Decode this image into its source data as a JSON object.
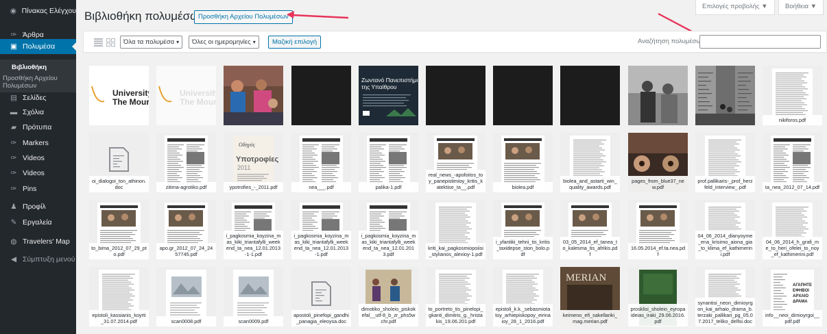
{
  "sidebar": {
    "items": [
      {
        "label": "Πίνακας Ελέγχου",
        "icon": "dashboard-icon",
        "glyph": "◉"
      },
      {
        "label": "Άρθρα",
        "icon": "pin-icon",
        "glyph": "✑"
      },
      {
        "label": "Πολυμέσα",
        "icon": "media-icon",
        "glyph": "▣"
      },
      {
        "label": "Σελίδες",
        "icon": "page-icon",
        "glyph": "▤"
      },
      {
        "label": "Σχόλια",
        "icon": "comments-icon",
        "glyph": "▬"
      },
      {
        "label": "Πρότυπα",
        "icon": "folder-icon",
        "glyph": "▰"
      },
      {
        "label": "Markers",
        "icon": "pin-icon",
        "glyph": "✑"
      },
      {
        "label": "Videos",
        "icon": "pin-icon",
        "glyph": "✑"
      },
      {
        "label": "Videos",
        "icon": "pin-icon",
        "glyph": "✑"
      },
      {
        "label": "Pins",
        "icon": "pin-icon",
        "glyph": "✑"
      },
      {
        "label": "Προφίλ",
        "icon": "user-icon",
        "glyph": "♟"
      },
      {
        "label": "Εργαλεία",
        "icon": "wrench-icon",
        "glyph": "✎"
      },
      {
        "label": "Travelers' Map",
        "icon": "globe-icon",
        "glyph": "◍"
      },
      {
        "label": "Σύμπτυξη μενού",
        "icon": "collapse-icon",
        "glyph": "◀"
      }
    ],
    "submenu": {
      "library": "Βιβλιοθήκη",
      "add_new_line1": "Προσθήκη Αρχείου",
      "add_new_line2": "Πολυμέσων"
    }
  },
  "header": {
    "title": "Βιβλιοθήκη πολυμέσων",
    "add_new": "Προσθήκη Αρχείου Πολυμέσων",
    "screen_options": "Επιλογές προβολής ▼",
    "help": "Βοήθεια ▼"
  },
  "filters": {
    "media_type": "Όλα τα πολυμέσα",
    "dates": "Όλες οι ημερομηνίες",
    "bulk_select": "Μαζική επιλογή",
    "search_label": "Αναζήτηση πολυμέσων",
    "search_value": ""
  },
  "colors": {
    "sidebar_bg": "#23282d",
    "accent": "#0073aa",
    "arrow": "#e8335a"
  },
  "media": [
    {
      "caption": "",
      "kind": "logo"
    },
    {
      "caption": "",
      "kind": "logo-faded"
    },
    {
      "caption": "",
      "kind": "photo-people"
    },
    {
      "caption": "",
      "kind": "dark"
    },
    {
      "caption": "",
      "kind": "slide"
    },
    {
      "caption": "",
      "kind": "dark"
    },
    {
      "caption": "",
      "kind": "dark"
    },
    {
      "caption": "",
      "kind": "dark"
    },
    {
      "caption": "",
      "kind": "photo-bw"
    },
    {
      "caption": "",
      "kind": "photo-street"
    },
    {
      "caption": "nikiforos.pdf",
      "kind": "text"
    },
    {
      "caption": "oi_dialogoi_ton_athinon.doc",
      "kind": "doc"
    },
    {
      "caption": "zitima-agrotiko.pdf",
      "kind": "newspaper"
    },
    {
      "caption": "ypotrofies_-_2011.pdf",
      "kind": "magazine"
    },
    {
      "caption": "nea___.pdf",
      "kind": "newspaper"
    },
    {
      "caption": "palika-1.pdf",
      "kind": "newspaper"
    },
    {
      "caption": "real_news_-apofoitos_toy_panepistimioy_kritis_katektise_ta__.pdf",
      "kind": "newspaper-photo"
    },
    {
      "caption": "biolea.pdf",
      "kind": "newspaper-photo"
    },
    {
      "caption": "biolea_and_astarti_win_quality_awards.pdf",
      "kind": "text"
    },
    {
      "caption": "pages_from_blue37_new.pdf",
      "kind": "faces"
    },
    {
      "caption": "prof.pallikaris-_prof_herzfeld_interview_.pdf",
      "kind": "text"
    },
    {
      "caption": "ta_nea_2012_07_14.pdf",
      "kind": "newspaper"
    },
    {
      "caption": "to_bima_2012_07_29_pto.pdf",
      "kind": "newspaper-photo"
    },
    {
      "caption": "apo.gr_2012_07_24_2457745.pdf",
      "kind": "newspaper-photo"
    },
    {
      "caption": "i_pagkosmia_koyzina_mas_kiki_triantafylli_weekend_ta_nea_12.01.2013-1-1.pdf",
      "kind": "newspaper"
    },
    {
      "caption": "i_pagkosmia_koyzina_mas_kiki_triantafylli_weekend_ta_nea_12.01.2013-1.pdf",
      "kind": "newspaper"
    },
    {
      "caption": "i_pagkosmia_koyzina_mas_kiki_triantafylli_weekend_ta_nea_12.01.2013.pdf",
      "kind": "newspaper"
    },
    {
      "caption": "kriti_kai_pagkosmiopoiisi_stylianos_alexioy-1.pdf",
      "kind": "text"
    },
    {
      "caption": "i_yfantiki_tehni_tis_kritis_taxidepse_ston_bolo.pdf",
      "kind": "newspaper-photo"
    },
    {
      "caption": "03_05_2014_ef_tanea_to_kalesma_tis_afrikis.pdf",
      "kind": "newspaper-photo"
    },
    {
      "caption": "16.05.2014_ef.ta.nea.pdf",
      "kind": "newspaper-photo"
    },
    {
      "caption": "04_06_2014_dianyoyme_ena_krisimo_aiona_gia_to_klima_ef_kathimerini.pdf",
      "kind": "text"
    },
    {
      "caption": "04_06_2014_h_grafi_me_to_heri_ofelei_to_noy_ef_kathimerini.pdf",
      "kind": "text"
    },
    {
      "caption": "epistoli_kassianis_koyrti_31.07.2014.pdf",
      "kind": "text"
    },
    {
      "caption": "scan0008.pdf",
      "kind": "scan"
    },
    {
      "caption": "scan0009.pdf",
      "kind": "scan"
    },
    {
      "caption": "apostoli_pinefopi_gandhi_panagia_eleoysa.doc",
      "kind": "doc"
    },
    {
      "caption": "dimotiko_sholeio_piskokefal__utf-8_b_zr_phs5wchr.pdf",
      "kind": "photo-event"
    },
    {
      "caption": "to_portreto_tis_pinelopi_gkanti_dimitris_g._hristakis_19.06.201.pdf",
      "kind": "text"
    },
    {
      "caption": "epistoli_k.k._sebasmiotatoy_arhiepiskopoy_eirinaioy_28_1_2016.pdf",
      "kind": "text"
    },
    {
      "caption": "keimeno_efi_sakellariki_mag.merian.pdf",
      "kind": "merian"
    },
    {
      "caption": "prosklisi_sholeio_eyropaideias_iraki_29.06.2016.pdf",
      "kind": "green"
    },
    {
      "caption": "synantisi_neon_dimioyrgon_kai_arhaio_drama_b.terzaki_pallikari_pg_05.07.2017_teliko_delfoi.doc",
      "kind": "text"
    },
    {
      "caption": "info__neoi_dimioyrgoi__pdf.pdf",
      "kind": "poster"
    }
  ]
}
